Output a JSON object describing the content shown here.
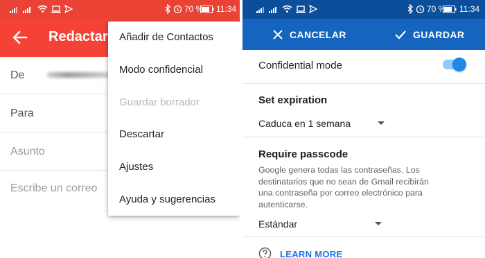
{
  "left_screen": {
    "status_bar": {
      "battery_percent": "70 %",
      "time": "11:34"
    },
    "app_bar": {
      "title": "Redactar"
    },
    "fields": {
      "from_label": "De",
      "to_label": "Para",
      "subject_placeholder": "Asunto",
      "body_placeholder": "Escribe un correo"
    },
    "overflow_menu": {
      "items": [
        {
          "label": "Añadir de Contactos",
          "enabled": true
        },
        {
          "label": "Modo confidencial",
          "enabled": true
        },
        {
          "label": "Guardar borrador",
          "enabled": false
        },
        {
          "label": "Descartar",
          "enabled": true
        },
        {
          "label": "Ajustes",
          "enabled": true
        },
        {
          "label": "Ayuda y sugerencias",
          "enabled": true
        }
      ]
    },
    "colors": {
      "status_bar": "#ea4335",
      "app_bar": "#f44336"
    }
  },
  "right_screen": {
    "status_bar": {
      "battery_percent": "70 %",
      "time": "11:34"
    },
    "app_bar": {
      "cancel_label": "CANCELAR",
      "save_label": "GUARDAR"
    },
    "confidential_mode": {
      "label": "Confidential mode",
      "enabled": true
    },
    "expiration": {
      "title": "Set expiration",
      "selected": "Caduca en 1 semana"
    },
    "passcode": {
      "title": "Require passcode",
      "description_lines": [
        "Google genera todas las contraseñas. Los",
        "destinatarios que no sean de Gmail recibirán",
        "una contraseña por correo electrónico para",
        "autenticarse."
      ],
      "selected": "Estándar"
    },
    "learn_more": "LEARN MORE",
    "colors": {
      "status_bar": "#0b4e9b",
      "app_bar": "#1565c0",
      "toggle": "#1e88e5",
      "link": "#1a73e8"
    }
  },
  "icons": [
    "signal-icon",
    "wifi-icon",
    "laptop-icon",
    "send-icon",
    "bluetooth-icon",
    "battery-icon",
    "back-arrow-icon",
    "close-icon",
    "check-icon",
    "dropdown-caret-icon",
    "help-circle-icon"
  ]
}
